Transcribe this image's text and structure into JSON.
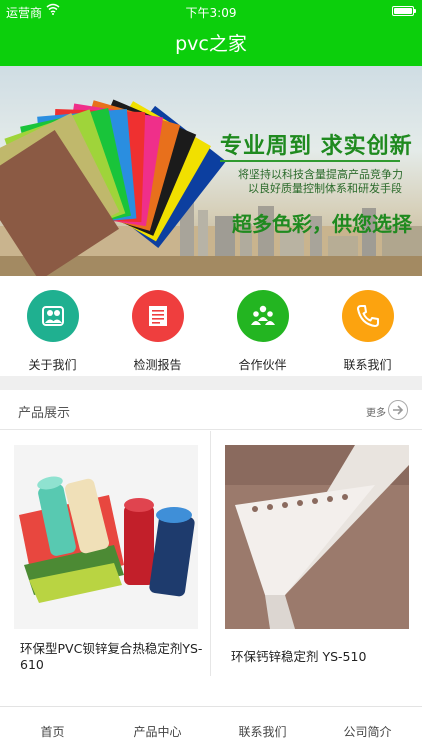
{
  "status_bar": {
    "carrier": "运营商",
    "time": "下午3:09"
  },
  "nav": {
    "title": "pvc之家"
  },
  "banner": {
    "slogan": "专业周到 求实创新",
    "line1": "将坚持以科技含量提高产品竞争力",
    "line2": "以良好质量控制体系和研发手段",
    "tagline": "超多色彩，供您选择"
  },
  "quick_links": [
    {
      "label": "关于我们",
      "icon": "people-icon",
      "color": "#1fb090"
    },
    {
      "label": "检测报告",
      "icon": "document-icon",
      "color": "#ef3e3e"
    },
    {
      "label": "合作伙伴",
      "icon": "group-icon",
      "color": "#23b521"
    },
    {
      "label": "联系我们",
      "icon": "phone-icon",
      "color": "#fca30f"
    }
  ],
  "products_section": {
    "title": "产品展示",
    "more": "更多"
  },
  "products": [
    {
      "name": "环保型PVC钡锌复合热稳定剂YS-610"
    },
    {
      "name": "环保钙锌稳定剂 YS-510"
    }
  ],
  "tabbar": {
    "tabs": [
      "首页",
      "产品中心",
      "联系我们",
      "公司简介"
    ]
  },
  "colors": {
    "brand": "#0ccf0c"
  }
}
